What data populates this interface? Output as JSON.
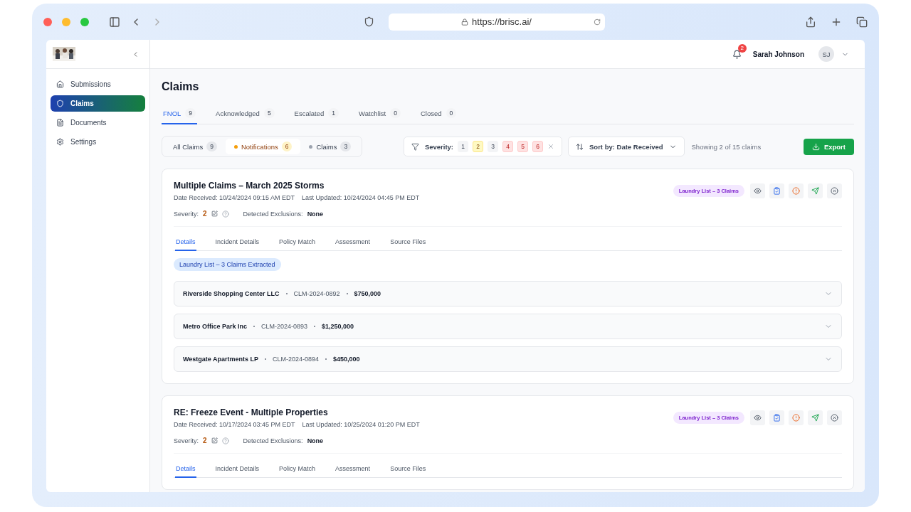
{
  "browser": {
    "url": "https://brisc.ai/"
  },
  "header": {
    "notifications": "2",
    "user_name": "Sarah Johnson",
    "user_initials": "SJ"
  },
  "sidebar": {
    "items": [
      {
        "label": "Submissions",
        "selected": false
      },
      {
        "label": "Claims",
        "selected": true
      },
      {
        "label": "Documents",
        "selected": false
      },
      {
        "label": "Settings",
        "selected": false
      }
    ]
  },
  "page": {
    "title": "Claims"
  },
  "tabs": [
    {
      "label": "FNOL",
      "count": "9",
      "selected": true
    },
    {
      "label": "Acknowledged",
      "count": "5",
      "selected": false
    },
    {
      "label": "Escalated",
      "count": "1",
      "selected": false
    },
    {
      "label": "Watchlist",
      "count": "0",
      "selected": false
    },
    {
      "label": "Closed",
      "count": "0",
      "selected": false
    }
  ],
  "filters": [
    {
      "label": "All Claims",
      "count": "9",
      "selected": false
    },
    {
      "label": "Notifications",
      "count": "6",
      "selected": true,
      "color": "#f59e0b"
    },
    {
      "label": "Claims",
      "count": "3",
      "selected": false,
      "color": "#9ca3af"
    }
  ],
  "severity_filter": {
    "label": "Severity:",
    "levels": [
      {
        "label": "1",
        "kind": "neutral"
      },
      {
        "label": "2",
        "kind": "warning"
      },
      {
        "label": "3",
        "kind": "neutral"
      },
      {
        "label": "4",
        "kind": "danger"
      },
      {
        "label": "5",
        "kind": "danger"
      },
      {
        "label": "6",
        "kind": "danger"
      }
    ]
  },
  "sort": {
    "label": "Sort by: Date Received"
  },
  "showing": "Showing 2 of 15 claims",
  "export_button": "Export",
  "claims": [
    {
      "title": "Multiple Claims – March 2025 Storms",
      "badge": "Laundry List – 3 Claims",
      "date_received": "Date Received: 10/24/2024 09:15 AM EDT",
      "last_updated": "Last Updated: 10/24/2024 04:45 PM EDT",
      "severity_label": "Severity:",
      "severity": "2",
      "exclusions_label": "Detected Exclusions:",
      "exclusions": "None",
      "tabs": [
        {
          "label": "Details",
          "selected": true
        },
        {
          "label": "Incident Details",
          "selected": false
        },
        {
          "label": "Policy Match",
          "selected": false
        },
        {
          "label": "Assessment",
          "selected": false
        },
        {
          "label": "Source Files",
          "selected": false
        }
      ],
      "extracted": "Laundry List – 3 Claims Extracted",
      "items": [
        {
          "name": "Riverside Shopping Center LLC",
          "number": "CLM-2024-0892",
          "amount": "$750,000"
        },
        {
          "name": "Metro Office Park Inc",
          "number": "CLM-2024-0893",
          "amount": "$1,250,000"
        },
        {
          "name": "Westgate Apartments LP",
          "number": "CLM-2024-0894",
          "amount": "$450,000"
        }
      ]
    },
    {
      "title": "RE: Freeze Event - Multiple Properties",
      "badge": "Laundry List – 3 Claims",
      "date_received": "Date Received: 10/17/2024 03:45 PM EDT",
      "last_updated": "Last Updated: 10/25/2024 01:20 PM EDT",
      "severity_label": "Severity:",
      "severity": "2",
      "exclusions_label": "Detected Exclusions:",
      "exclusions": "None",
      "tabs": [
        {
          "label": "Details",
          "selected": true
        },
        {
          "label": "Incident Details",
          "selected": false
        },
        {
          "label": "Policy Match",
          "selected": false
        },
        {
          "label": "Assessment",
          "selected": false
        },
        {
          "label": "Source Files",
          "selected": false
        }
      ]
    }
  ]
}
